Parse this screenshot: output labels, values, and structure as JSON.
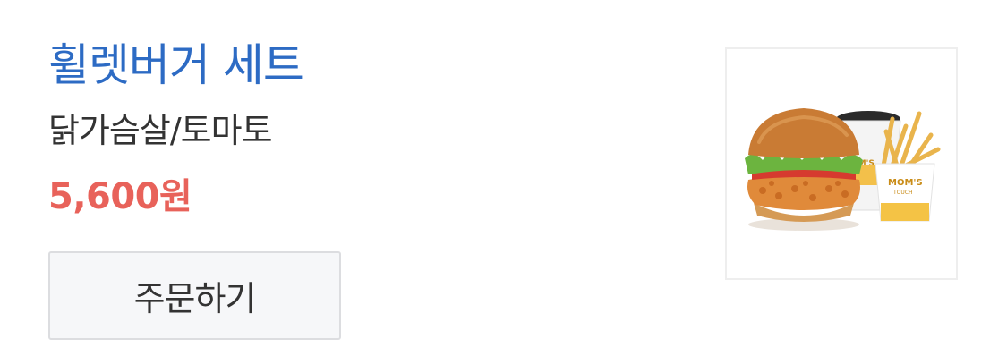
{
  "menu_item": {
    "name": "휠렛버거 세트",
    "option": "닭가슴살/토마토",
    "price": "5,600원",
    "order_label": "주문하기",
    "image": {
      "depicts": "burger-set-photo",
      "brand_text": "MOM'S TOUCH"
    }
  },
  "colors": {
    "title": "#2d6bc4",
    "price": "#e8625a",
    "text": "#333333",
    "button_bg": "#f6f7f9",
    "button_border": "#dcdde0"
  }
}
